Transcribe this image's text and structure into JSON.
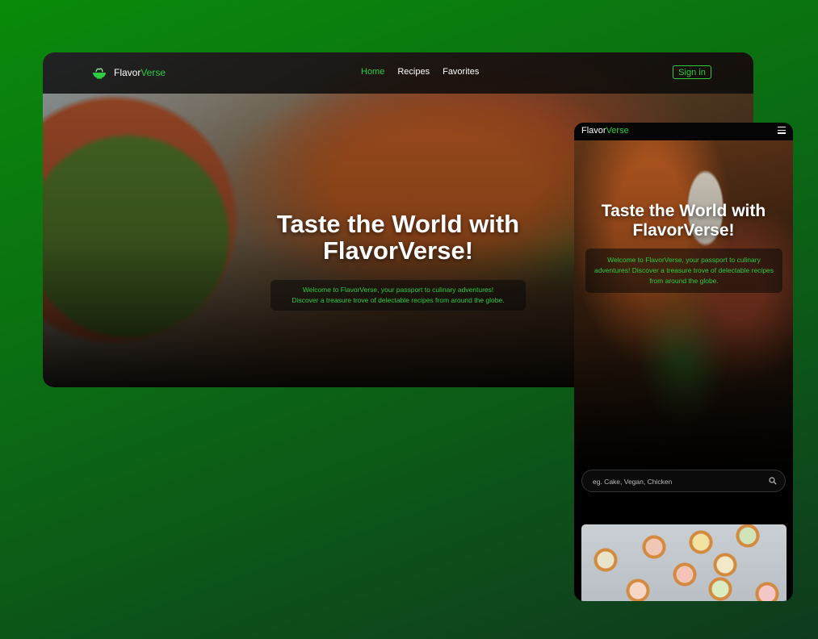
{
  "desktop": {
    "brand": {
      "part1": "Flavor",
      "part2": "Verse"
    },
    "nav": {
      "home": "Home",
      "recipes": "Recipes",
      "favorites": "Favorites"
    },
    "sign_in": "Sign in",
    "hero": {
      "title": "Taste the World with FlavorVerse!",
      "subtitle_line1": "Welcome to FlavorVerse, your passport to culinary adventures!",
      "subtitle_line2": "Discover a treasure trove of delectable recipes from around the globe."
    }
  },
  "mobile": {
    "brand": {
      "part1": "Flavor",
      "part2": "Verse"
    },
    "hero": {
      "title": "Taste the World with FlavorVerse!",
      "subtitle": "Welcome to FlavorVerse, your passport to culinary adventures! Discover a treasure trove of delectable recipes from around the globe."
    },
    "search": {
      "placeholder": "eg. Cake, Vegan, Chicken"
    }
  },
  "colors": {
    "accent": "#2ecc40",
    "background": "#0b7a12"
  },
  "icons": {
    "logo": "bowl-icon",
    "menu": "menu-icon",
    "search": "search-icon"
  }
}
